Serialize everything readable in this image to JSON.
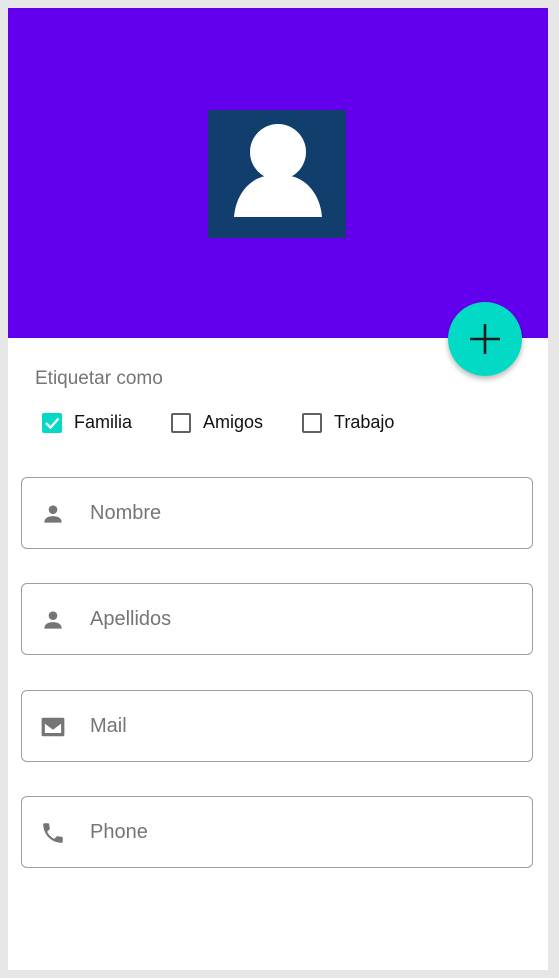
{
  "header": {
    "background_color": "#6200ee",
    "avatar_icon": "person-placeholder-icon"
  },
  "fab": {
    "icon": "plus-icon",
    "color": "#03dac5"
  },
  "tags": {
    "heading": "Etiquetar como",
    "options": [
      {
        "label": "Familia",
        "checked": true
      },
      {
        "label": "Amigos",
        "checked": false
      },
      {
        "label": "Trabajo",
        "checked": false
      }
    ]
  },
  "fields": [
    {
      "icon": "person-icon",
      "placeholder": "Nombre"
    },
    {
      "icon": "person-icon",
      "placeholder": "Apellidos"
    },
    {
      "icon": "mail-icon",
      "placeholder": "Mail"
    },
    {
      "icon": "phone-icon",
      "placeholder": "Phone"
    }
  ]
}
